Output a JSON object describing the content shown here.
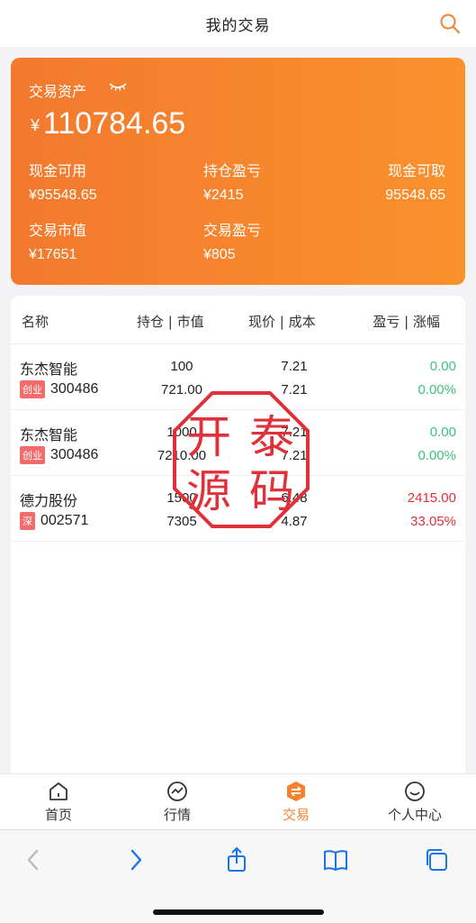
{
  "header": {
    "title": "我的交易"
  },
  "assets": {
    "label": "交易资产",
    "currency": "¥",
    "total": "110784.65",
    "cash_available_label": "现金可用",
    "cash_available": "¥95548.65",
    "holding_pl_label": "持仓盈亏",
    "holding_pl": "¥2415",
    "cash_withdraw_label": "现金可取",
    "cash_withdraw": "95548.65",
    "market_value_label": "交易市值",
    "market_value": "¥17651",
    "trade_pl_label": "交易盈亏",
    "trade_pl": "¥805"
  },
  "table": {
    "headers": [
      "名称",
      "持仓 | 市值",
      "现价 | 成本",
      "盈亏 | 涨幅"
    ],
    "rows": [
      {
        "name": "东杰智能",
        "board": "创业",
        "code": "300486",
        "qty": "100",
        "mv": "721.00",
        "price": "7.21",
        "cost": "7.21",
        "pl": "0.00",
        "pct": "0.00%"
      },
      {
        "name": "东杰智能",
        "board": "创业",
        "code": "300486",
        "qty": "1000",
        "mv": "7210.00",
        "price": "7.21",
        "cost": "7.21",
        "pl": "0.00",
        "pct": "0.00%"
      },
      {
        "name": "德力股份",
        "board": "深",
        "code": "002571",
        "qty": "1500",
        "mv": "7305",
        "price": "6.48",
        "cost": "4.87",
        "pl": "2415.00",
        "pct": "33.05%"
      }
    ]
  },
  "seal": {
    "chars": [
      "开",
      "泰",
      "源",
      "码"
    ]
  },
  "tabs": [
    {
      "label": "首页"
    },
    {
      "label": "行情"
    },
    {
      "label": "交易"
    },
    {
      "label": "个人中心"
    }
  ],
  "colors": {
    "accent": "#f5822e",
    "gain": "#e0303a",
    "flat": "#3ec27d"
  }
}
